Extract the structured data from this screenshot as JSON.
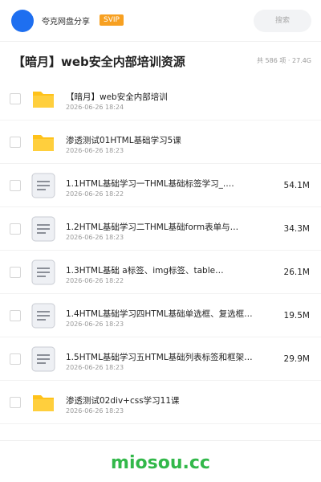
{
  "header": {
    "brand": "夸克网盘分享",
    "badge": "SVIP",
    "search_placeholder": "搜索"
  },
  "share": {
    "title": "【暗月】web安全内部培训资源",
    "meta": "共 586 项 · 27.4G"
  },
  "files": [
    {
      "type": "folder",
      "icon": "folder-icon",
      "name": "【暗月】web安全内部培训",
      "date": "2026-06-26 18:24",
      "size": ""
    },
    {
      "type": "folder",
      "icon": "folder-icon",
      "name": "渗透测试01HTML基础学习5课",
      "date": "2026-06-26 18:23",
      "size": ""
    },
    {
      "type": "file",
      "icon": "document-icon",
      "name": "1.1HTML基础学习一THML基础标签学习_.…",
      "date": "2026-06-26 18:22",
      "size": "54.1M"
    },
    {
      "type": "file",
      "icon": "document-icon",
      "name": "1.2HTML基础学习二THML基础form表单与…",
      "date": "2026-06-26 18:23",
      "size": "34.3M"
    },
    {
      "type": "file",
      "icon": "document-icon",
      "name": "1.3HTML基础 a标签、img标签、table…",
      "date": "2026-06-26 18:22",
      "size": "26.1M"
    },
    {
      "type": "file",
      "icon": "document-icon",
      "name": "1.4HTML基础学习四HTML基础单选框、复选框…",
      "date": "2026-06-26 18:23",
      "size": "19.5M"
    },
    {
      "type": "file",
      "icon": "document-icon",
      "name": "1.5HTML基础学习五HTML基础列表标签和框架…",
      "date": "2026-06-26 18:23",
      "size": "29.9M"
    },
    {
      "type": "folder",
      "icon": "folder-icon",
      "name": "渗透测试02div+css学习11课",
      "date": "2026-06-26 18:23",
      "size": ""
    }
  ],
  "watermark": "miosou.cc",
  "colors": {
    "accent": "#1e6ff0",
    "svip": "#f7a021",
    "folder": "#ffc21a",
    "watermark": "#32b84a"
  }
}
